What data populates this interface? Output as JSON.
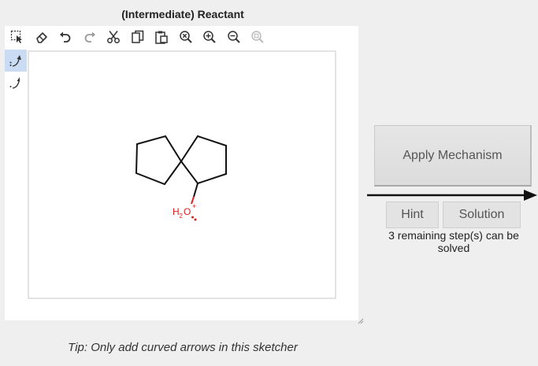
{
  "title": "(Intermediate) Reactant",
  "toolbar": {
    "tools": [
      {
        "name": "select-icon",
        "label": "Select"
      },
      {
        "name": "erase-icon",
        "label": "Erase"
      },
      {
        "name": "undo-icon",
        "label": "Undo"
      },
      {
        "name": "redo-icon",
        "label": "Redo"
      },
      {
        "name": "cut-icon",
        "label": "Cut"
      },
      {
        "name": "copy-icon",
        "label": "Copy"
      },
      {
        "name": "paste-icon",
        "label": "Paste"
      },
      {
        "name": "zoom-clear-icon",
        "label": "Clear zoom"
      },
      {
        "name": "zoom-in-icon",
        "label": "Zoom in"
      },
      {
        "name": "zoom-out-icon",
        "label": "Zoom out"
      },
      {
        "name": "zoom-reset-icon",
        "label": "Reset zoom"
      }
    ]
  },
  "side_tools": [
    {
      "name": "curved-arrow-two-electron-icon",
      "active": true
    },
    {
      "name": "curved-arrow-one-electron-icon",
      "active": false
    }
  ],
  "molecule": {
    "oxygen_label": "O",
    "hydrogen_label": "H",
    "subscript": "2",
    "charge": "+",
    "atom_color": "#e02020"
  },
  "apply_button": "Apply Mechanism",
  "hint_button": "Hint",
  "solution_button": "Solution",
  "remaining_text": "3 remaining step(s) can be solved",
  "tip": "Tip: Only add curved arrows in this sketcher"
}
